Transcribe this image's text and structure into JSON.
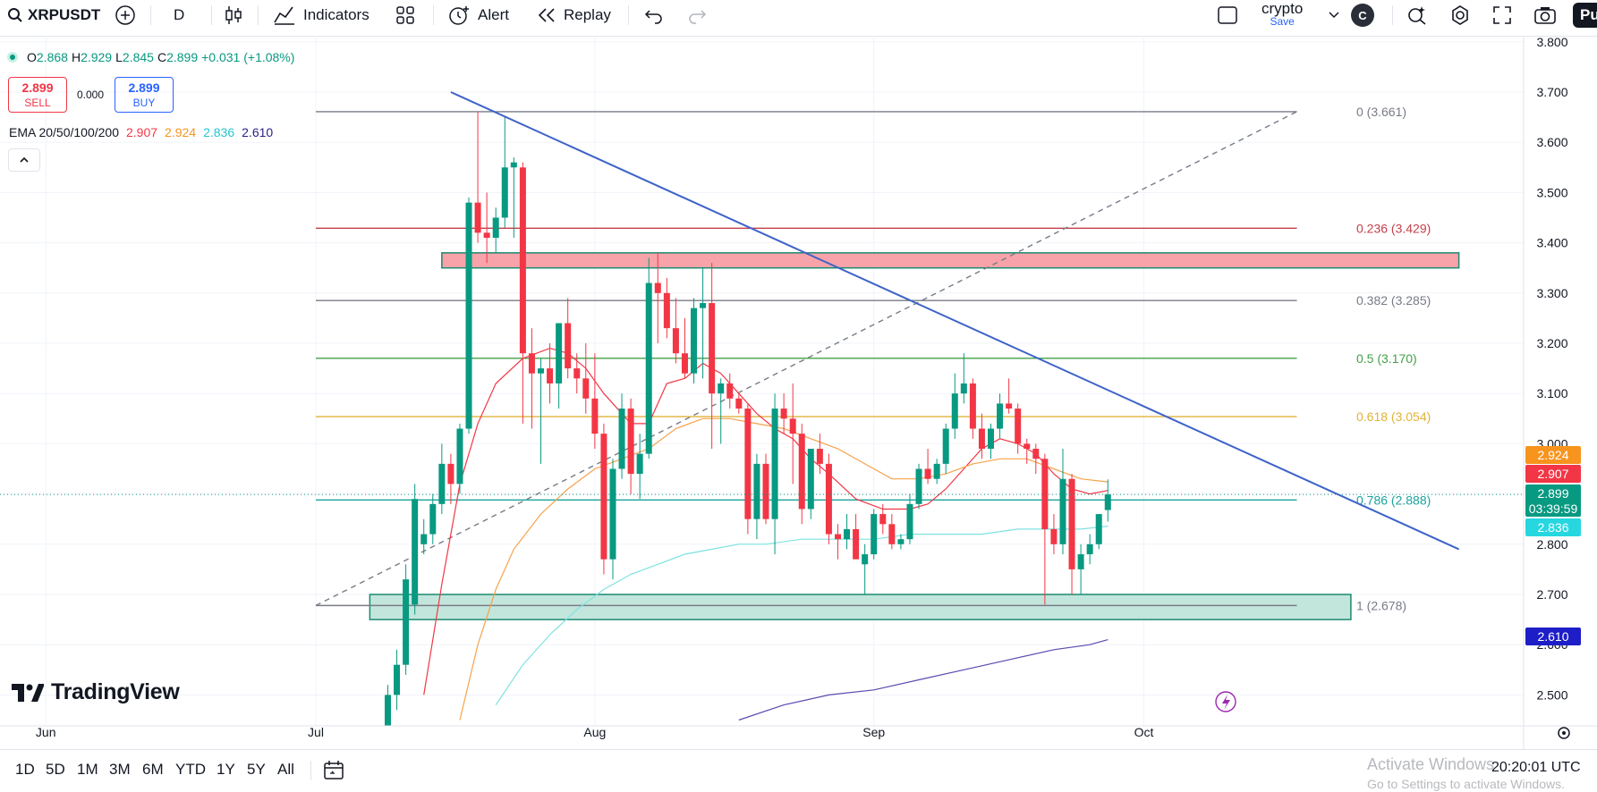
{
  "toolbar": {
    "symbol": "XRPUSDT",
    "interval": "D",
    "indicators_label": "Indicators",
    "alert_label": "Alert",
    "replay_label": "Replay",
    "layout_name": "crypto",
    "save_label": "Save",
    "avatar_letter": "C",
    "publish_label": "Pu"
  },
  "legend": {
    "o_label": "O",
    "o_value": "2.868",
    "h_label": "H",
    "h_value": "2.929",
    "l_label": "L",
    "l_value": "2.845",
    "c_label": "C",
    "c_value": "2.899",
    "change": "+0.031 (+1.08%)"
  },
  "trade": {
    "sell_price": "2.899",
    "sell_label": "SELL",
    "spread": "0.000",
    "buy_price": "2.899",
    "buy_label": "BUY"
  },
  "ema": {
    "label": "EMA 20/50/100/200",
    "v20": "2.907",
    "v50": "2.924",
    "v100": "2.836",
    "v200": "2.610"
  },
  "colors": {
    "up": "#089981",
    "down": "#f23645",
    "ema20": "#f23645",
    "ema50": "#f7a24a",
    "ema100": "#7de2e1",
    "ema200": "#5b49b0",
    "trendline": "#3d63c9"
  },
  "brand": "TradingView",
  "bottom": {
    "ranges": [
      "1D",
      "5D",
      "1M",
      "3M",
      "6M",
      "YTD",
      "1Y",
      "5Y",
      "All"
    ],
    "clock": "20:20:01 UTC",
    "activate_1": "Activate Windows",
    "activate_2": "Go to Settings to activate Windows."
  },
  "chart_data": {
    "type": "candlestick",
    "symbol": "XRPUSDT",
    "interval": "1D",
    "ylim": [
      2.45,
      3.81
    ],
    "y_ticks": [
      "3.800",
      "3.700",
      "3.600",
      "3.500",
      "3.400",
      "3.300",
      "3.200",
      "3.100",
      "3.000",
      "2.900",
      "2.800",
      "2.700",
      "2.600",
      "2.500"
    ],
    "x_labels": [
      "Jun",
      "Jul",
      "Aug",
      "Sep",
      "Oct"
    ],
    "x_label_days": [
      -30,
      0,
      31,
      62,
      92
    ],
    "candles": [
      [
        8,
        2.33,
        2.52,
        2.3,
        2.5
      ],
      [
        9,
        2.5,
        2.59,
        2.47,
        2.56
      ],
      [
        10,
        2.56,
        2.76,
        2.54,
        2.73
      ],
      [
        11,
        2.68,
        2.92,
        2.66,
        2.89
      ],
      [
        12,
        2.8,
        2.85,
        2.78,
        2.82
      ],
      [
        13,
        2.82,
        2.9,
        2.8,
        2.88
      ],
      [
        14,
        2.88,
        3.0,
        2.86,
        2.96
      ],
      [
        15,
        2.96,
        2.98,
        2.88,
        2.92
      ],
      [
        16,
        2.92,
        3.04,
        2.9,
        3.03
      ],
      [
        17,
        3.03,
        3.49,
        3.02,
        3.48
      ],
      [
        18,
        3.48,
        3.66,
        3.4,
        3.42
      ],
      [
        19,
        3.42,
        3.5,
        3.36,
        3.41
      ],
      [
        20,
        3.41,
        3.47,
        3.38,
        3.45
      ],
      [
        21,
        3.45,
        3.65,
        3.43,
        3.55
      ],
      [
        22,
        3.55,
        3.57,
        3.41,
        3.56
      ],
      [
        23,
        3.55,
        3.56,
        3.04,
        3.18
      ],
      [
        24,
        3.18,
        3.23,
        3.03,
        3.14
      ],
      [
        25,
        3.14,
        3.17,
        2.96,
        3.15
      ],
      [
        26,
        3.15,
        3.2,
        3.08,
        3.12
      ],
      [
        27,
        3.12,
        3.24,
        3.07,
        3.24
      ],
      [
        28,
        3.24,
        3.29,
        3.13,
        3.15
      ],
      [
        29,
        3.15,
        3.18,
        3.1,
        3.13
      ],
      [
        30,
        3.13,
        3.2,
        3.06,
        3.09
      ],
      [
        31,
        3.09,
        3.18,
        2.99,
        3.02
      ],
      [
        32,
        3.02,
        3.04,
        2.74,
        2.77
      ],
      [
        33,
        2.77,
        2.97,
        2.73,
        2.95
      ],
      [
        34,
        2.95,
        3.1,
        2.93,
        3.07
      ],
      [
        35,
        3.07,
        3.09,
        2.9,
        2.94
      ],
      [
        36,
        2.94,
        3.02,
        2.89,
        2.98
      ],
      [
        37,
        2.98,
        3.37,
        2.97,
        3.32
      ],
      [
        38,
        3.32,
        3.38,
        3.2,
        3.3
      ],
      [
        39,
        3.3,
        3.33,
        3.21,
        3.23
      ],
      [
        40,
        3.23,
        3.29,
        3.16,
        3.18
      ],
      [
        41,
        3.18,
        3.25,
        3.13,
        3.14
      ],
      [
        42,
        3.14,
        3.29,
        3.12,
        3.27
      ],
      [
        43,
        3.27,
        3.35,
        3.13,
        3.28
      ],
      [
        44,
        3.28,
        3.36,
        2.99,
        3.1
      ],
      [
        45,
        3.1,
        3.13,
        3.0,
        3.12
      ],
      [
        46,
        3.12,
        3.14,
        3.07,
        3.09
      ],
      [
        47,
        3.09,
        3.1,
        3.06,
        3.07
      ],
      [
        48,
        3.07,
        3.08,
        2.82,
        2.85
      ],
      [
        49,
        2.85,
        2.98,
        2.81,
        2.96
      ],
      [
        50,
        2.96,
        2.98,
        2.84,
        2.85
      ],
      [
        51,
        2.85,
        3.1,
        2.78,
        3.07
      ],
      [
        52,
        3.07,
        3.1,
        3.02,
        3.05
      ],
      [
        53,
        3.05,
        3.12,
        2.92,
        3.02
      ],
      [
        54,
        3.02,
        3.04,
        2.84,
        2.87
      ],
      [
        55,
        2.87,
        2.99,
        2.85,
        2.99
      ],
      [
        56,
        2.99,
        3.02,
        2.94,
        2.96
      ],
      [
        57,
        2.96,
        2.98,
        2.8,
        2.82
      ],
      [
        58,
        2.82,
        2.84,
        2.77,
        2.81
      ],
      [
        59,
        2.81,
        2.86,
        2.79,
        2.83
      ],
      [
        60,
        2.83,
        2.86,
        2.79,
        2.77
      ],
      [
        61,
        2.76,
        2.8,
        2.7,
        2.78
      ],
      [
        62,
        2.78,
        2.87,
        2.77,
        2.86
      ],
      [
        63,
        2.86,
        2.88,
        2.82,
        2.84
      ],
      [
        64,
        2.84,
        2.86,
        2.79,
        2.8
      ],
      [
        65,
        2.8,
        2.82,
        2.79,
        2.81
      ],
      [
        66,
        2.81,
        2.9,
        2.8,
        2.88
      ],
      [
        67,
        2.88,
        2.96,
        2.87,
        2.95
      ],
      [
        68,
        2.95,
        2.99,
        2.92,
        2.93
      ],
      [
        69,
        2.93,
        2.97,
        2.92,
        2.96
      ],
      [
        70,
        2.96,
        3.04,
        2.94,
        3.03
      ],
      [
        71,
        3.03,
        3.14,
        3.01,
        3.1
      ],
      [
        72,
        3.1,
        3.18,
        3.08,
        3.12
      ],
      [
        73,
        3.12,
        3.13,
        3.01,
        3.03
      ],
      [
        74,
        3.03,
        3.06,
        2.97,
        2.99
      ],
      [
        75,
        2.99,
        3.04,
        2.97,
        3.03
      ],
      [
        76,
        3.03,
        3.1,
        3.01,
        3.08
      ],
      [
        77,
        3.08,
        3.13,
        3.06,
        3.07
      ],
      [
        78,
        3.07,
        3.08,
        2.98,
        3.0
      ],
      [
        79,
        3.0,
        3.01,
        2.96,
        2.99
      ],
      [
        80,
        2.99,
        3.0,
        2.94,
        2.97
      ],
      [
        81,
        2.97,
        2.98,
        2.68,
        2.83
      ],
      [
        82,
        2.83,
        2.86,
        2.78,
        2.8
      ],
      [
        83,
        2.8,
        2.99,
        2.78,
        2.93
      ],
      [
        84,
        2.93,
        2.94,
        2.7,
        2.75
      ],
      [
        85,
        2.75,
        2.8,
        2.7,
        2.78
      ],
      [
        86,
        2.78,
        2.82,
        2.76,
        2.8
      ],
      [
        87,
        2.8,
        2.86,
        2.79,
        2.86
      ],
      [
        88,
        2.868,
        2.929,
        2.845,
        2.899
      ]
    ],
    "ema": [
      {
        "name": "EMA 20",
        "color": "#f23645",
        "points": [
          [
            12,
            2.5
          ],
          [
            14,
            2.72
          ],
          [
            16,
            2.92
          ],
          [
            18,
            3.04
          ],
          [
            20,
            3.12
          ],
          [
            23,
            3.17
          ],
          [
            26,
            3.19
          ],
          [
            28,
            3.18
          ],
          [
            30,
            3.15
          ],
          [
            32,
            3.1
          ],
          [
            35,
            3.04
          ],
          [
            37,
            3.04
          ],
          [
            39,
            3.12
          ],
          [
            41,
            3.13
          ],
          [
            43,
            3.16
          ],
          [
            45,
            3.14
          ],
          [
            47,
            3.1
          ],
          [
            49,
            3.06
          ],
          [
            51,
            3.03
          ],
          [
            53,
            3.01
          ],
          [
            55,
            2.97
          ],
          [
            57,
            2.94
          ],
          [
            60,
            2.89
          ],
          [
            63,
            2.87
          ],
          [
            66,
            2.87
          ],
          [
            68,
            2.88
          ],
          [
            70,
            2.91
          ],
          [
            72,
            2.95
          ],
          [
            74,
            2.99
          ],
          [
            76,
            3.01
          ],
          [
            78,
            3.0
          ],
          [
            80,
            2.98
          ],
          [
            82,
            2.94
          ],
          [
            84,
            2.91
          ],
          [
            86,
            2.9
          ],
          [
            88,
            2.907
          ]
        ]
      },
      {
        "name": "EMA 50",
        "color": "#f7a24a",
        "points": [
          [
            16,
            2.45
          ],
          [
            18,
            2.6
          ],
          [
            20,
            2.71
          ],
          [
            22,
            2.79
          ],
          [
            25,
            2.86
          ],
          [
            28,
            2.91
          ],
          [
            31,
            2.95
          ],
          [
            34,
            2.97
          ],
          [
            37,
            2.99
          ],
          [
            40,
            3.03
          ],
          [
            43,
            3.05
          ],
          [
            46,
            3.05
          ],
          [
            49,
            3.04
          ],
          [
            52,
            3.03
          ],
          [
            55,
            3.01
          ],
          [
            58,
            2.99
          ],
          [
            61,
            2.96
          ],
          [
            64,
            2.93
          ],
          [
            67,
            2.93
          ],
          [
            70,
            2.94
          ],
          [
            73,
            2.96
          ],
          [
            76,
            2.97
          ],
          [
            79,
            2.97
          ],
          [
            82,
            2.95
          ],
          [
            85,
            2.93
          ],
          [
            88,
            2.924
          ]
        ]
      },
      {
        "name": "EMA 100",
        "color": "#7de2e1",
        "points": [
          [
            20,
            2.48
          ],
          [
            23,
            2.56
          ],
          [
            26,
            2.62
          ],
          [
            29,
            2.67
          ],
          [
            32,
            2.71
          ],
          [
            35,
            2.74
          ],
          [
            38,
            2.76
          ],
          [
            41,
            2.78
          ],
          [
            44,
            2.79
          ],
          [
            47,
            2.8
          ],
          [
            50,
            2.8
          ],
          [
            54,
            2.81
          ],
          [
            58,
            2.81
          ],
          [
            62,
            2.81
          ],
          [
            66,
            2.82
          ],
          [
            70,
            2.82
          ],
          [
            74,
            2.82
          ],
          [
            78,
            2.83
          ],
          [
            82,
            2.83
          ],
          [
            85,
            2.83
          ],
          [
            88,
            2.836
          ]
        ]
      },
      {
        "name": "EMA 200",
        "color": "#5b49b0",
        "points": [
          [
            47,
            2.45
          ],
          [
            52,
            2.48
          ],
          [
            57,
            2.5
          ],
          [
            62,
            2.51
          ],
          [
            67,
            2.53
          ],
          [
            72,
            2.55
          ],
          [
            77,
            2.57
          ],
          [
            82,
            2.59
          ],
          [
            86,
            2.6
          ],
          [
            88,
            2.61
          ]
        ]
      }
    ],
    "fib_levels": [
      {
        "label": "0 (3.661)",
        "value": 3.661,
        "color": "#787b86"
      },
      {
        "label": "0.236 (3.429)",
        "value": 3.429,
        "color": "#c2404a"
      },
      {
        "label": "0.382 (3.285)",
        "value": 3.285,
        "color": "#787b86"
      },
      {
        "label": "0.5 (3.170)",
        "value": 3.17,
        "color": "#43a047"
      },
      {
        "label": "0.618 (3.054)",
        "value": 3.054,
        "color": "#e0b23a"
      },
      {
        "label": "0.786 (2.888)",
        "value": 2.888,
        "color": "#1ba39c"
      },
      {
        "label": "1 (2.678)",
        "value": 2.678,
        "color": "#787b86"
      }
    ],
    "fib_start_day": 0,
    "fib_end_day": 109,
    "fib_diagonal": {
      "from": [
        0,
        2.678
      ],
      "to": [
        109,
        3.661
      ]
    },
    "zones": [
      {
        "name": "resistance",
        "from_day": 14,
        "to_day": 127,
        "low": 3.35,
        "high": 3.38,
        "fill": "#f7a3a9",
        "stroke": "#1b8a70"
      },
      {
        "name": "support",
        "from_day": 6,
        "to_day": 115,
        "low": 2.65,
        "high": 2.7,
        "fill": "#c3e6dc",
        "stroke": "#1b8a70"
      }
    ],
    "trendline": {
      "from": [
        15,
        3.7
      ],
      "to": [
        127,
        2.79
      ]
    },
    "price_labels": [
      {
        "text": "2.924",
        "value": 2.924,
        "bg": "#f7941e"
      },
      {
        "text": "2.907",
        "value": 2.907,
        "bg": "#f23645"
      },
      {
        "text": "2.899",
        "sub": "03:39:59",
        "value": 2.899,
        "bg": "#089981"
      },
      {
        "text": "2.836",
        "value": 2.836,
        "bg": "#26d7e0"
      },
      {
        "text": "2.610",
        "value": 2.61,
        "bg": "#1e1ec8"
      }
    ]
  }
}
